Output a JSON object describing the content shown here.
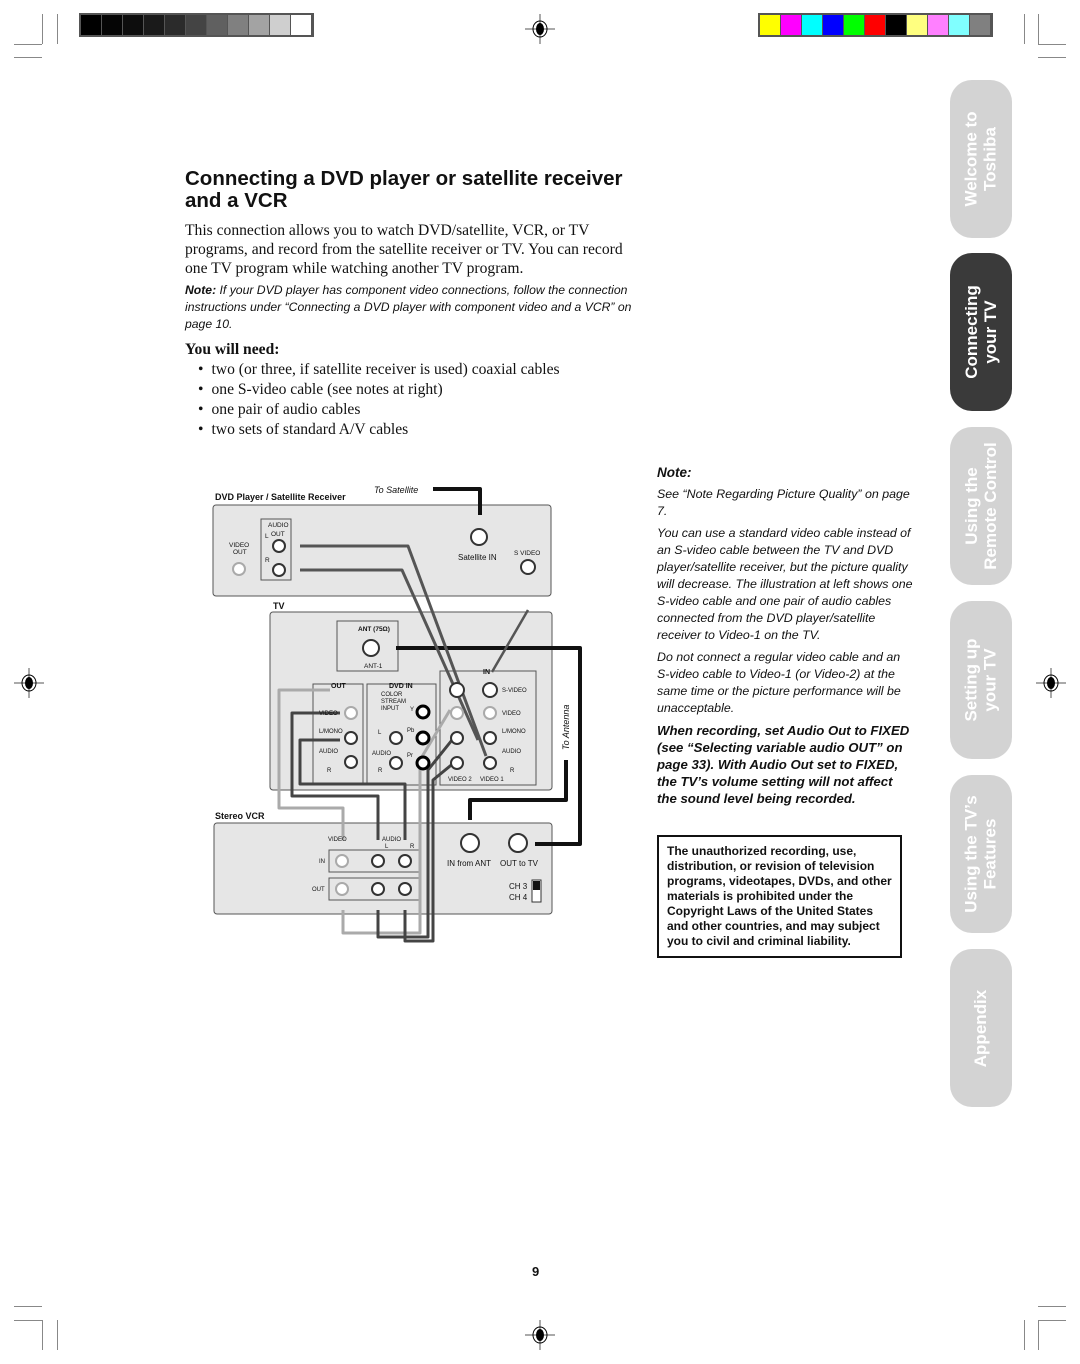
{
  "registration": {
    "gray_bars": [
      "#000000",
      "#050505",
      "#0d0d0d",
      "#1a1a1a",
      "#2b2b2b",
      "#444444",
      "#606060",
      "#808080",
      "#a3a3a3",
      "#cfcfcf",
      "#ffffff"
    ],
    "color_bars": [
      "#ffff00",
      "#ff00ff",
      "#00ffff",
      "#0000ff",
      "#00ff00",
      "#ff0000",
      "#000000",
      "#ffff80",
      "#ff80ff",
      "#80ffff",
      "#808080"
    ]
  },
  "page": {
    "title": "Connecting a DVD player or satellite receiver and a VCR",
    "intro": "This connection allows you to watch DVD/satellite, VCR, or TV programs, and record from the satellite receiver or TV. You can record one TV program while watching another TV program.",
    "note_label": "Note:",
    "note_text": " If your DVD player has component video connections, follow the connection instructions under “Connecting a DVD player with component video and a VCR” on page 10.",
    "need_heading": "You will need:",
    "need_items": [
      "two (or three, if satellite receiver is used) coaxial cables",
      "one S-video cable (see notes at right)",
      "one pair of audio cables",
      "two sets of standard A/V cables"
    ],
    "page_number": "9"
  },
  "side_notes": {
    "heading": "Note:",
    "p1": "See “Note Regarding Picture Quality” on page 7.",
    "p2": "You can use a standard video cable instead of an S-video cable between the TV and DVD player/satellite receiver, but the picture quality will decrease. The illustration at left shows one S-video cable and one pair of audio cables connected from the DVD player/satellite receiver to Video-1 on the TV.",
    "p3": "Do not connect a regular video cable and an S-video cable to Video-1 (or Video-2) at the same time or the picture performance will be unacceptable.",
    "p4": "When recording, set Audio Out to FIXED (see “Selecting variable audio OUT” on page 33). With Audio Out set to FIXED, the TV’s volume setting will not affect the sound level being recorded.",
    "copyright": "The unauthorized recording, use, distribution, or revision of television programs, videotapes, DVDs, and other materials is prohibited under the Copyright Laws of the United States and other countries, and may subject you to civil and criminal liability."
  },
  "tabs": [
    {
      "line1": "Welcome to",
      "line2": "Toshiba",
      "active": false
    },
    {
      "line1": "Connecting",
      "line2": "your TV",
      "active": true
    },
    {
      "line1": "Using the",
      "line2": "Remote Control",
      "active": false
    },
    {
      "line1": "Setting up",
      "line2": "your TV",
      "active": false
    },
    {
      "line1": "Using the TV’s",
      "line2": "Features",
      "active": false
    },
    {
      "line1": "Appendix",
      "line2": "",
      "active": false
    }
  ],
  "diagram": {
    "dvd_label": "DVD Player / Satellite Receiver",
    "to_satellite": "To Satellite",
    "audio": "AUDIO",
    "out": "OUT",
    "l": "L",
    "r": "R",
    "video_out_1": "VIDEO",
    "video_out_2": "OUT",
    "satellite_in": "Satellite IN",
    "s_video": "S VIDEO",
    "tv_label": "TV",
    "ant": "ANT (75Ω)",
    "ant1": "ANT-1",
    "tv_out": "OUT",
    "dvd_in": "DVD IN",
    "in": "IN",
    "color": "COLOR",
    "stream": "STREAM",
    "input": "INPUT",
    "y": "Y",
    "pb": "Pb",
    "pr": "Pr",
    "video": "VIDEO",
    "lmono": "L/MONO",
    "s_video_in": "S-VIDEO",
    "video2": "VIDEO 2",
    "video1": "VIDEO 1",
    "to_antenna": "To Antenna",
    "vcr_label": "Stereo VCR",
    "vcr_video": "VIDEO",
    "vcr_in": "IN",
    "vcr_out": "OUT",
    "in_from_ant": "IN from ANT",
    "out_to_tv": "OUT to TV",
    "ch3": "CH 3",
    "ch4": "CH 4"
  }
}
